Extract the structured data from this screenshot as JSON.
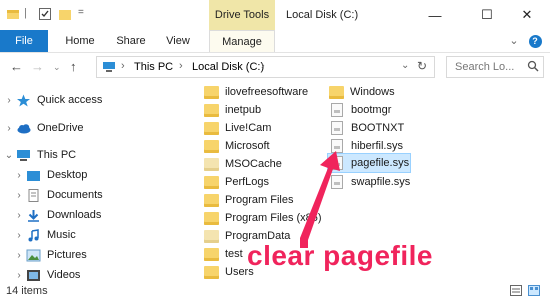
{
  "titlebar": {
    "context_tab": "Drive Tools",
    "window_title": "Local Disk (C:)",
    "minimize_glyph": "—",
    "maximize_glyph": "☐",
    "close_glyph": "✕"
  },
  "ribbon": {
    "tabs": [
      "File",
      "Home",
      "Share",
      "View",
      "Manage"
    ],
    "expand_glyph": "⌄",
    "help_glyph": "?"
  },
  "address": {
    "path": [
      "This PC",
      "Local Disk (C:)"
    ],
    "search_placeholder": "Search Lo..."
  },
  "navpane": {
    "items": [
      {
        "label": "Quick access",
        "icon": "star-icon"
      },
      {
        "label": "OneDrive",
        "icon": "cloud-icon"
      },
      {
        "label": "This PC",
        "icon": "computer-icon"
      },
      {
        "label": "Desktop",
        "icon": "desktop-folder-icon"
      },
      {
        "label": "Documents",
        "icon": "documents-icon"
      },
      {
        "label": "Downloads",
        "icon": "download-icon"
      },
      {
        "label": "Music",
        "icon": "music-icon"
      },
      {
        "label": "Pictures",
        "icon": "pictures-icon"
      },
      {
        "label": "Videos",
        "icon": "videos-icon"
      }
    ]
  },
  "files": {
    "col1": [
      "ilovefreesoftware",
      "inetpub",
      "Live!Cam",
      "Microsoft",
      "MSOCache",
      "PerfLogs",
      "Program Files",
      "Program Files (x86)",
      "ProgramData",
      "test",
      "Users"
    ],
    "col2": [
      "Windows",
      "bootmgr",
      "BOOTNXT",
      "hiberfil.sys",
      "pagefile.sys",
      "swapfile.sys"
    ]
  },
  "status": {
    "item_count": "14 items"
  },
  "annotation": {
    "text": "clear pagefile",
    "color": "#f0245c"
  },
  "colors": {
    "file_tab": "#1979ca",
    "context_tab": "#f0e6a8",
    "selection": "#cce8ff"
  }
}
